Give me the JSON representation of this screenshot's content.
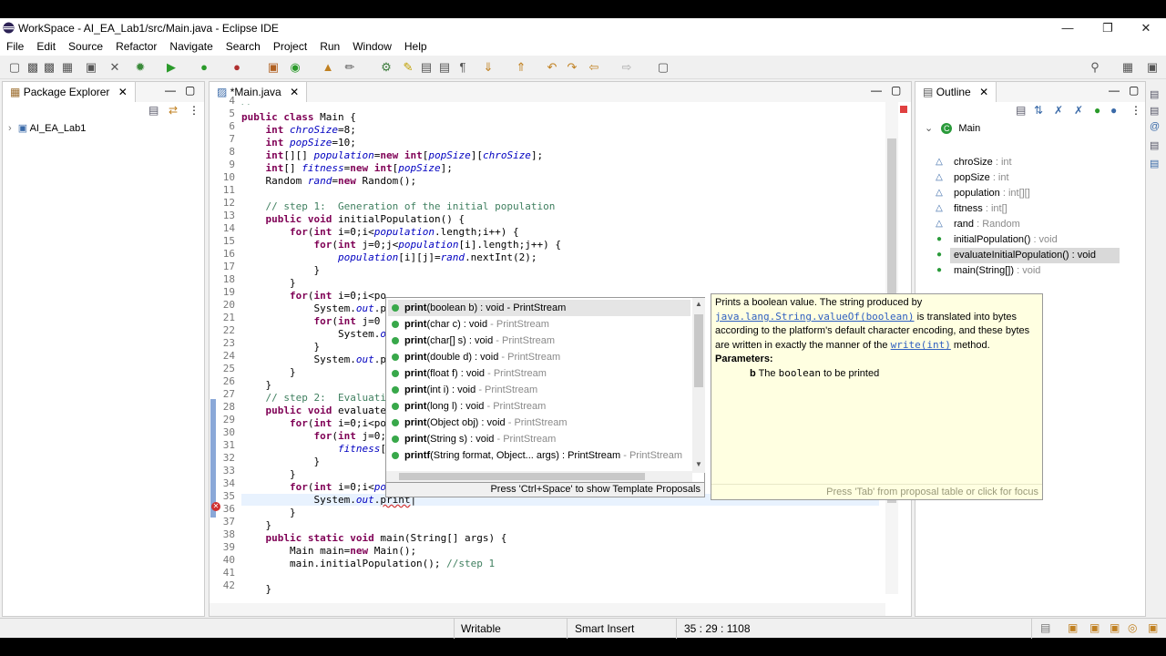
{
  "window": {
    "title": "WorkSpace - AI_EA_Lab1/src/Main.java - Eclipse IDE"
  },
  "menu": [
    "File",
    "Edit",
    "Source",
    "Refactor",
    "Navigate",
    "Search",
    "Project",
    "Run",
    "Window",
    "Help"
  ],
  "package_explorer": {
    "tab": "Package Explorer",
    "project": "AI_EA_Lab1"
  },
  "editor": {
    "tab": "*Main.java",
    "line_numbers": [
      "4",
      "5",
      "6",
      "7",
      "8",
      "9",
      "10",
      "11",
      "12",
      "13",
      "14",
      "15",
      "16",
      "17",
      "18",
      "19",
      "20",
      "21",
      "22",
      "23",
      "24",
      "25",
      "26",
      "27",
      "28",
      "29",
      "30",
      "31",
      "32",
      "33",
      "34",
      "35",
      "36",
      "37",
      "38",
      "39",
      "40",
      "41",
      "42"
    ]
  },
  "completion": {
    "items": [
      {
        "name": "print",
        "rest": "(boolean b) : void",
        "owner": "- PrintStream"
      },
      {
        "name": "print",
        "rest": "(char c) : void",
        "owner": "- PrintStream"
      },
      {
        "name": "print",
        "rest": "(char[] s) : void",
        "owner": "- PrintStream"
      },
      {
        "name": "print",
        "rest": "(double d) : void",
        "owner": "- PrintStream"
      },
      {
        "name": "print",
        "rest": "(float f) : void",
        "owner": "- PrintStream"
      },
      {
        "name": "print",
        "rest": "(int i) : void",
        "owner": "- PrintStream"
      },
      {
        "name": "print",
        "rest": "(long l) : void",
        "owner": "- PrintStream"
      },
      {
        "name": "print",
        "rest": "(Object obj) : void",
        "owner": "- PrintStream"
      },
      {
        "name": "print",
        "rest": "(String s) : void",
        "owner": "- PrintStream"
      },
      {
        "name": "printf",
        "rest": "(String format, Object... args) : PrintStream",
        "owner": "- PrintStream"
      }
    ],
    "footer": "Press 'Ctrl+Space' to show Template Proposals"
  },
  "javadoc": {
    "line1": "Prints a boolean value. The string produced by",
    "link1": "java.lang.String.valueOf(boolean)",
    "line2_rest": " is translated into bytes",
    "line3": "according to the platform's default character encoding, and these bytes",
    "line4": "are written in exactly the manner of the ",
    "link2": "write(int)",
    "line4_end": " method.",
    "params_label": "Parameters:",
    "param_name": "b",
    "param_desc_pre": " The ",
    "param_code": "boolean",
    "param_desc_post": " to be printed",
    "footer": "Press 'Tab' from proposal table or click for focus"
  },
  "outline": {
    "tab": "Outline",
    "class": "Main",
    "members": [
      {
        "name": "chroSize",
        "type": " : int"
      },
      {
        "name": "popSize",
        "type": " : int"
      },
      {
        "name": "population",
        "type": " : int[][]"
      },
      {
        "name": "fitness",
        "type": " : int[]"
      },
      {
        "name": "rand",
        "type": " : Random"
      },
      {
        "name": "initialPopulation()",
        "type": " : void"
      },
      {
        "name": "evaluateInitialPopulation()",
        "type": " : void"
      },
      {
        "name": "main(String[])",
        "type": " : void"
      }
    ]
  },
  "status": {
    "mode": "Writable",
    "insert": "Smart Insert",
    "position": "35 : 29 : 1108"
  },
  "colors": {
    "keyword": "#7f0055",
    "comment": "#3f7f5f",
    "field": "#0000c0",
    "method_dot": "#38a84a"
  }
}
